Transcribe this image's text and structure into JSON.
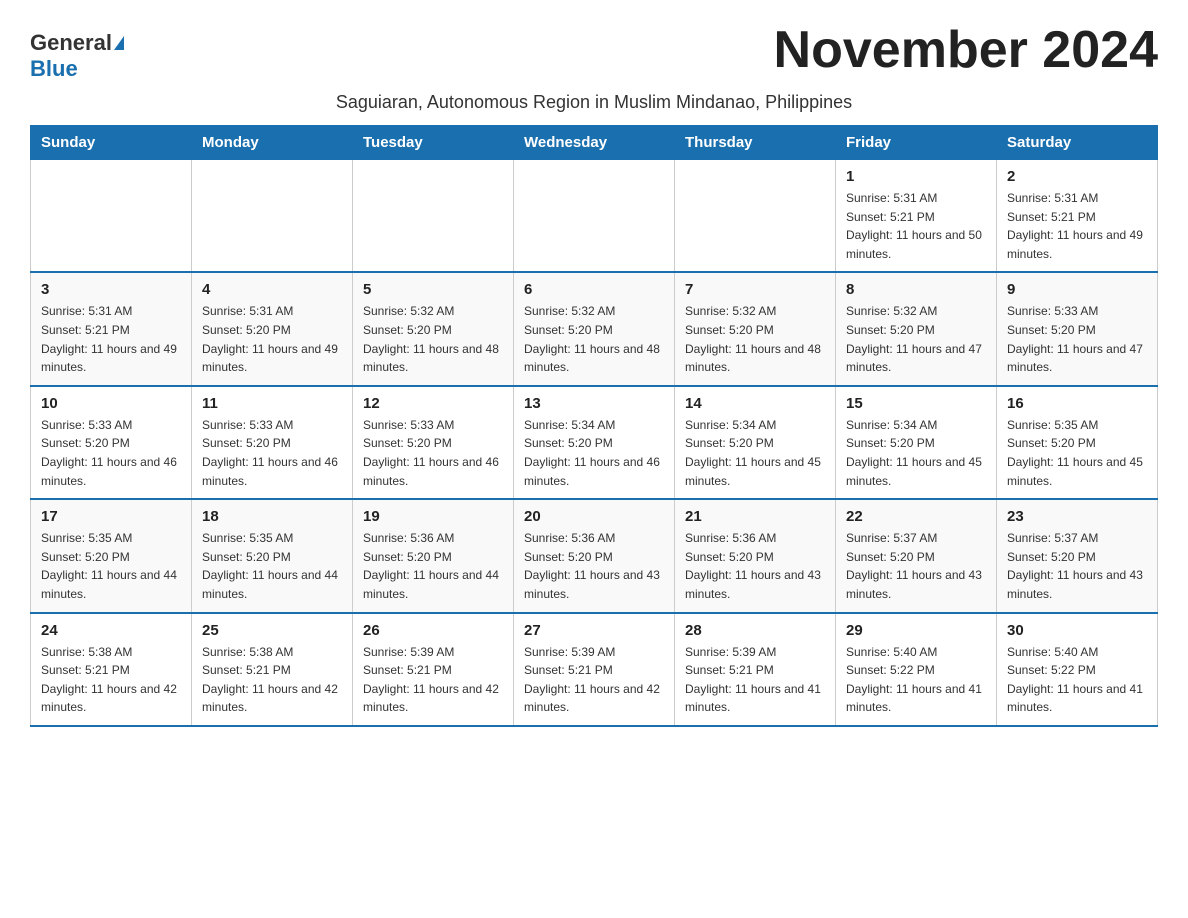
{
  "logo": {
    "general": "General",
    "blue": "Blue"
  },
  "title": "November 2024",
  "subtitle": "Saguiaran, Autonomous Region in Muslim Mindanao, Philippines",
  "days_of_week": [
    "Sunday",
    "Monday",
    "Tuesday",
    "Wednesday",
    "Thursday",
    "Friday",
    "Saturday"
  ],
  "weeks": [
    [
      {
        "day": "",
        "sunrise": "",
        "sunset": "",
        "daylight": ""
      },
      {
        "day": "",
        "sunrise": "",
        "sunset": "",
        "daylight": ""
      },
      {
        "day": "",
        "sunrise": "",
        "sunset": "",
        "daylight": ""
      },
      {
        "day": "",
        "sunrise": "",
        "sunset": "",
        "daylight": ""
      },
      {
        "day": "",
        "sunrise": "",
        "sunset": "",
        "daylight": ""
      },
      {
        "day": "1",
        "sunrise": "Sunrise: 5:31 AM",
        "sunset": "Sunset: 5:21 PM",
        "daylight": "Daylight: 11 hours and 50 minutes."
      },
      {
        "day": "2",
        "sunrise": "Sunrise: 5:31 AM",
        "sunset": "Sunset: 5:21 PM",
        "daylight": "Daylight: 11 hours and 49 minutes."
      }
    ],
    [
      {
        "day": "3",
        "sunrise": "Sunrise: 5:31 AM",
        "sunset": "Sunset: 5:21 PM",
        "daylight": "Daylight: 11 hours and 49 minutes."
      },
      {
        "day": "4",
        "sunrise": "Sunrise: 5:31 AM",
        "sunset": "Sunset: 5:20 PM",
        "daylight": "Daylight: 11 hours and 49 minutes."
      },
      {
        "day": "5",
        "sunrise": "Sunrise: 5:32 AM",
        "sunset": "Sunset: 5:20 PM",
        "daylight": "Daylight: 11 hours and 48 minutes."
      },
      {
        "day": "6",
        "sunrise": "Sunrise: 5:32 AM",
        "sunset": "Sunset: 5:20 PM",
        "daylight": "Daylight: 11 hours and 48 minutes."
      },
      {
        "day": "7",
        "sunrise": "Sunrise: 5:32 AM",
        "sunset": "Sunset: 5:20 PM",
        "daylight": "Daylight: 11 hours and 48 minutes."
      },
      {
        "day": "8",
        "sunrise": "Sunrise: 5:32 AM",
        "sunset": "Sunset: 5:20 PM",
        "daylight": "Daylight: 11 hours and 47 minutes."
      },
      {
        "day": "9",
        "sunrise": "Sunrise: 5:33 AM",
        "sunset": "Sunset: 5:20 PM",
        "daylight": "Daylight: 11 hours and 47 minutes."
      }
    ],
    [
      {
        "day": "10",
        "sunrise": "Sunrise: 5:33 AM",
        "sunset": "Sunset: 5:20 PM",
        "daylight": "Daylight: 11 hours and 46 minutes."
      },
      {
        "day": "11",
        "sunrise": "Sunrise: 5:33 AM",
        "sunset": "Sunset: 5:20 PM",
        "daylight": "Daylight: 11 hours and 46 minutes."
      },
      {
        "day": "12",
        "sunrise": "Sunrise: 5:33 AM",
        "sunset": "Sunset: 5:20 PM",
        "daylight": "Daylight: 11 hours and 46 minutes."
      },
      {
        "day": "13",
        "sunrise": "Sunrise: 5:34 AM",
        "sunset": "Sunset: 5:20 PM",
        "daylight": "Daylight: 11 hours and 46 minutes."
      },
      {
        "day": "14",
        "sunrise": "Sunrise: 5:34 AM",
        "sunset": "Sunset: 5:20 PM",
        "daylight": "Daylight: 11 hours and 45 minutes."
      },
      {
        "day": "15",
        "sunrise": "Sunrise: 5:34 AM",
        "sunset": "Sunset: 5:20 PM",
        "daylight": "Daylight: 11 hours and 45 minutes."
      },
      {
        "day": "16",
        "sunrise": "Sunrise: 5:35 AM",
        "sunset": "Sunset: 5:20 PM",
        "daylight": "Daylight: 11 hours and 45 minutes."
      }
    ],
    [
      {
        "day": "17",
        "sunrise": "Sunrise: 5:35 AM",
        "sunset": "Sunset: 5:20 PM",
        "daylight": "Daylight: 11 hours and 44 minutes."
      },
      {
        "day": "18",
        "sunrise": "Sunrise: 5:35 AM",
        "sunset": "Sunset: 5:20 PM",
        "daylight": "Daylight: 11 hours and 44 minutes."
      },
      {
        "day": "19",
        "sunrise": "Sunrise: 5:36 AM",
        "sunset": "Sunset: 5:20 PM",
        "daylight": "Daylight: 11 hours and 44 minutes."
      },
      {
        "day": "20",
        "sunrise": "Sunrise: 5:36 AM",
        "sunset": "Sunset: 5:20 PM",
        "daylight": "Daylight: 11 hours and 43 minutes."
      },
      {
        "day": "21",
        "sunrise": "Sunrise: 5:36 AM",
        "sunset": "Sunset: 5:20 PM",
        "daylight": "Daylight: 11 hours and 43 minutes."
      },
      {
        "day": "22",
        "sunrise": "Sunrise: 5:37 AM",
        "sunset": "Sunset: 5:20 PM",
        "daylight": "Daylight: 11 hours and 43 minutes."
      },
      {
        "day": "23",
        "sunrise": "Sunrise: 5:37 AM",
        "sunset": "Sunset: 5:20 PM",
        "daylight": "Daylight: 11 hours and 43 minutes."
      }
    ],
    [
      {
        "day": "24",
        "sunrise": "Sunrise: 5:38 AM",
        "sunset": "Sunset: 5:21 PM",
        "daylight": "Daylight: 11 hours and 42 minutes."
      },
      {
        "day": "25",
        "sunrise": "Sunrise: 5:38 AM",
        "sunset": "Sunset: 5:21 PM",
        "daylight": "Daylight: 11 hours and 42 minutes."
      },
      {
        "day": "26",
        "sunrise": "Sunrise: 5:39 AM",
        "sunset": "Sunset: 5:21 PM",
        "daylight": "Daylight: 11 hours and 42 minutes."
      },
      {
        "day": "27",
        "sunrise": "Sunrise: 5:39 AM",
        "sunset": "Sunset: 5:21 PM",
        "daylight": "Daylight: 11 hours and 42 minutes."
      },
      {
        "day": "28",
        "sunrise": "Sunrise: 5:39 AM",
        "sunset": "Sunset: 5:21 PM",
        "daylight": "Daylight: 11 hours and 41 minutes."
      },
      {
        "day": "29",
        "sunrise": "Sunrise: 5:40 AM",
        "sunset": "Sunset: 5:22 PM",
        "daylight": "Daylight: 11 hours and 41 minutes."
      },
      {
        "day": "30",
        "sunrise": "Sunrise: 5:40 AM",
        "sunset": "Sunset: 5:22 PM",
        "daylight": "Daylight: 11 hours and 41 minutes."
      }
    ]
  ]
}
